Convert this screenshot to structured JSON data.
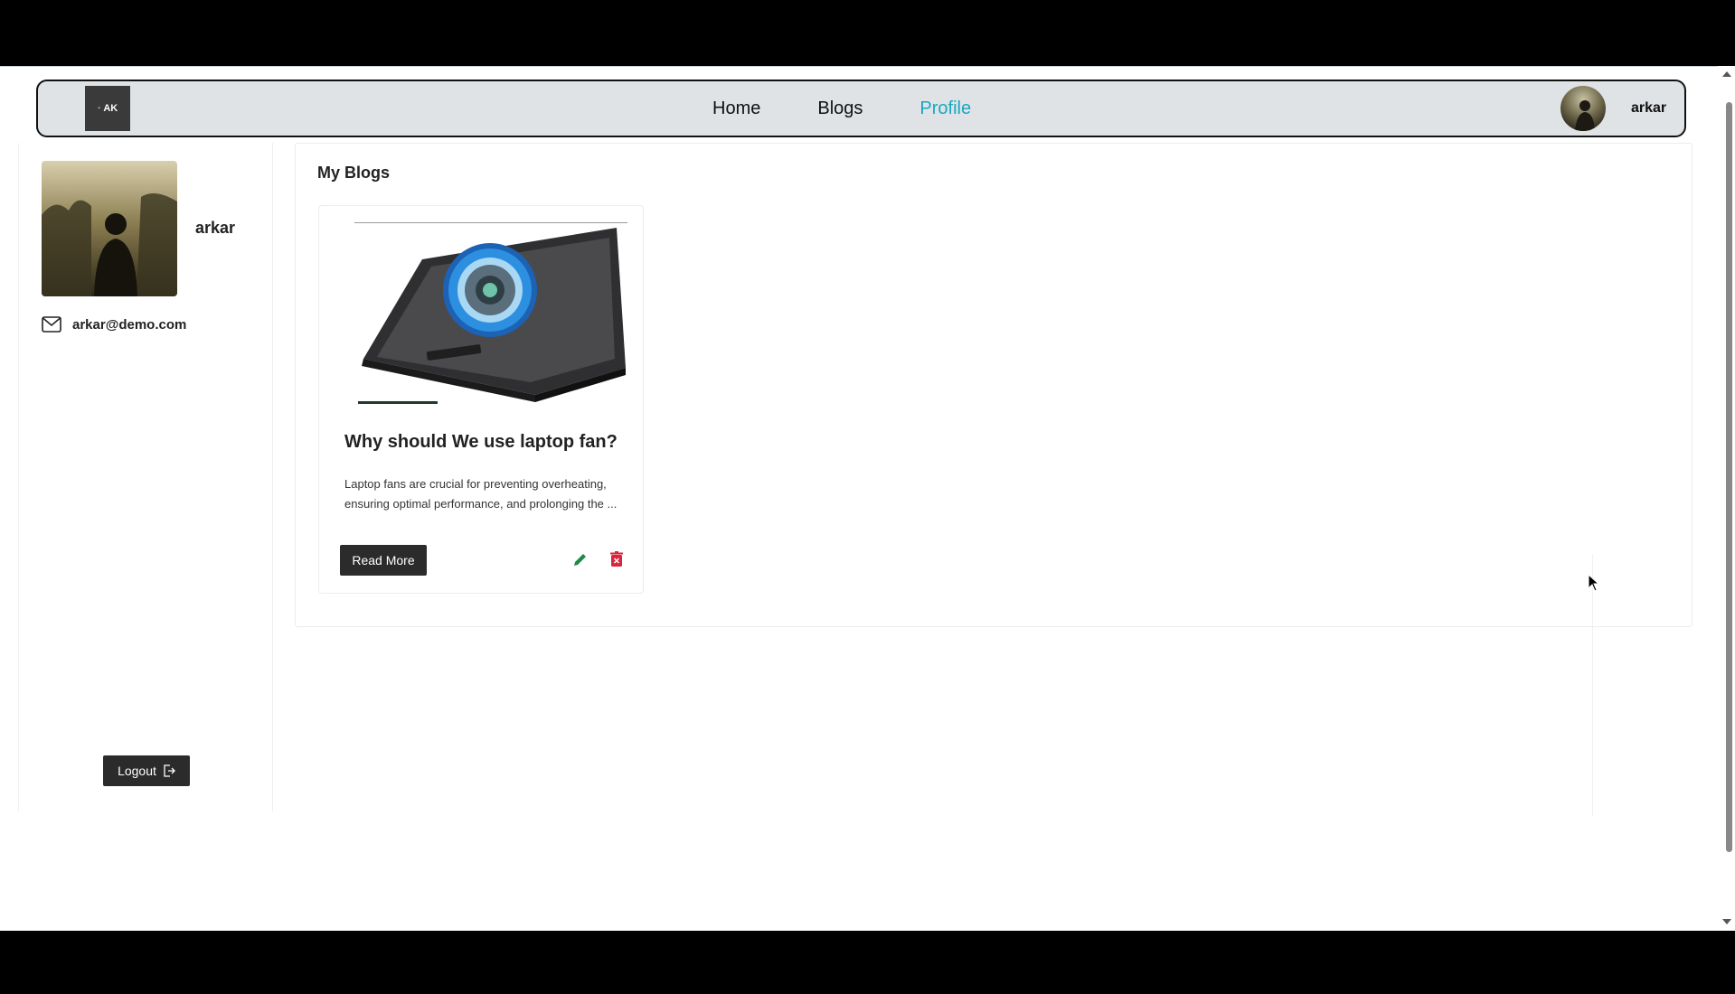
{
  "navbar": {
    "logo_text": "AK",
    "links": [
      {
        "label": "Home",
        "active": false
      },
      {
        "label": "Blogs",
        "active": false
      },
      {
        "label": "Profile",
        "active": true
      }
    ],
    "username": "arkar",
    "active_color": "#19a7c0"
  },
  "sidebar": {
    "name": "arkar",
    "email": "arkar@demo.com",
    "logout_label": "Logout"
  },
  "main": {
    "section_title": "My Blogs",
    "blogs": [
      {
        "title": "Why should We use laptop fan?",
        "excerpt": "Laptop fans are crucial for preventing overheating, ensuring optimal performance, and prolonging the ...",
        "read_more_label": "Read More"
      }
    ]
  },
  "icons": {
    "edit": "pencil-icon",
    "delete": "trash-icon",
    "mail": "mail-icon",
    "logout": "logout-icon",
    "edit_color": "#1e8a4a",
    "delete_color": "#d7263d"
  }
}
